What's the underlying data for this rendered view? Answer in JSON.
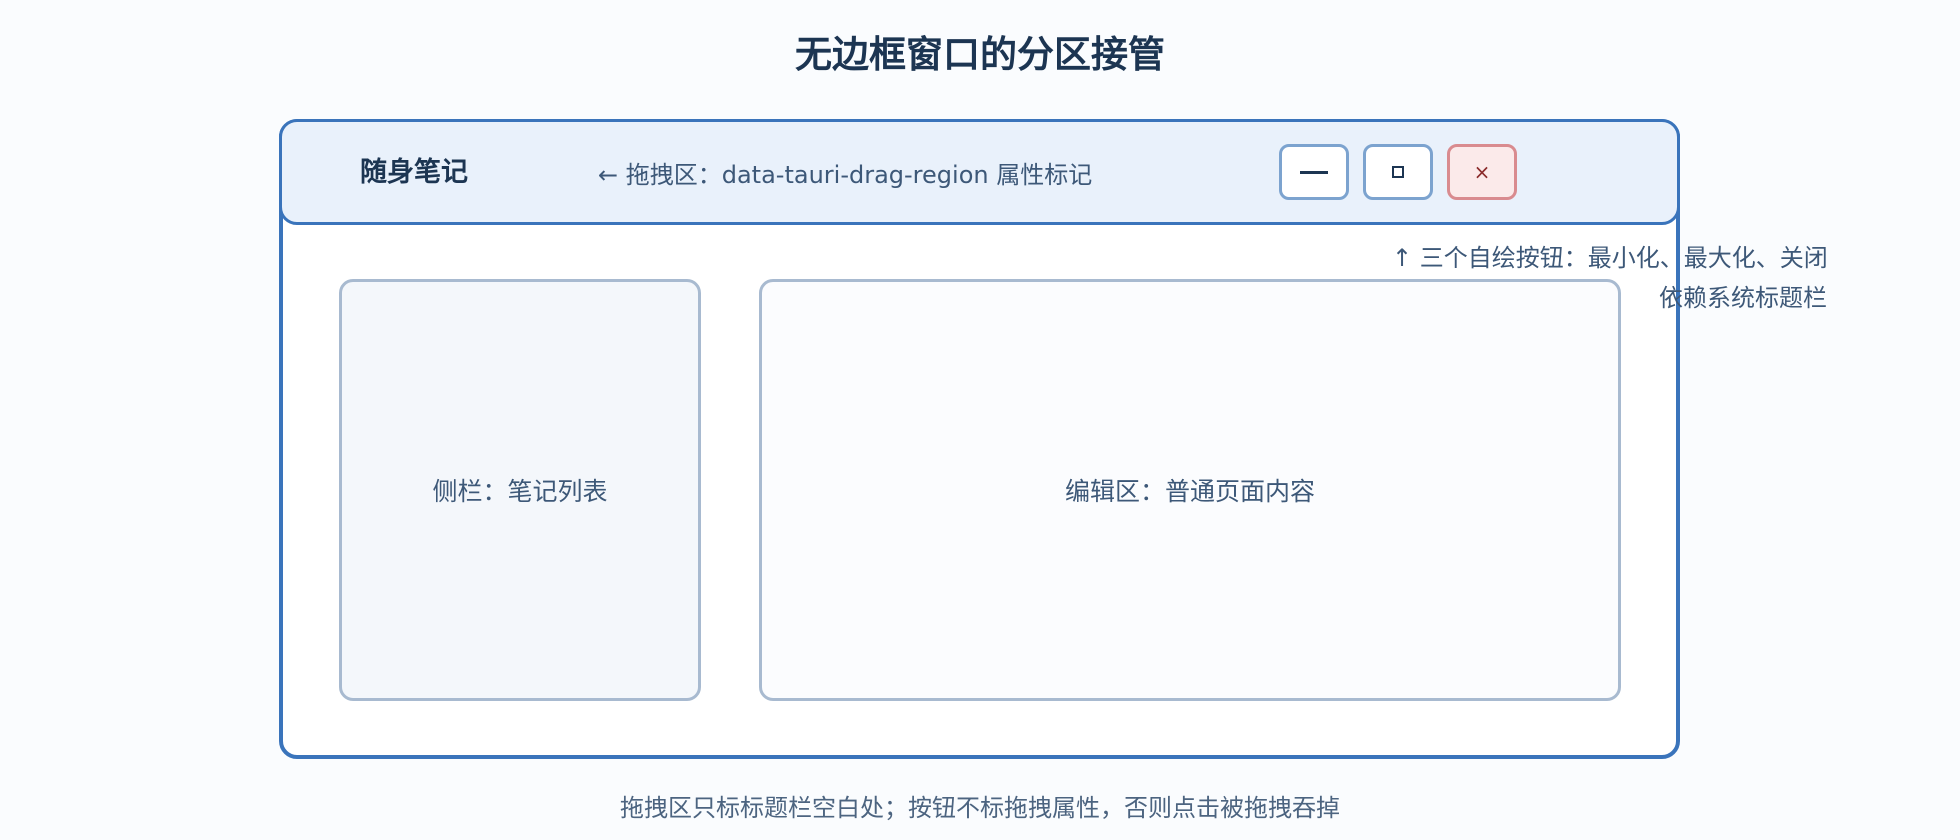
{
  "title": "无边框窗口的分区接管",
  "window": {
    "app_name": "随身笔记",
    "drag_region_note": "← 拖拽区：data-tauri-drag-region 属性标记",
    "buttons": {
      "minimize_icon": "minimize-dash",
      "maximize_icon": "maximize-square",
      "close_icon": "close-x",
      "close_glyph": "×",
      "close_color": "#d98b8f",
      "close_background": "#fbeaea"
    },
    "buttons_note": {
      "line1": "↑ 三个自绘按钮：最小化、最大化、关闭",
      "line2": "依赖系统标题栏"
    },
    "sidebar_label": "侧栏：笔记列表",
    "editor_label": "编辑区：普通页面内容"
  },
  "footer_note": "拖拽区只标标题栏空白处；按钮不标拖拽属性，否则点击被拖拽吞掉",
  "colors": {
    "frame_border": "#3a74bb",
    "titlebar_background": "#e9f1fb",
    "title_text": "#1c3552",
    "panel_border": "#a8bad0"
  }
}
